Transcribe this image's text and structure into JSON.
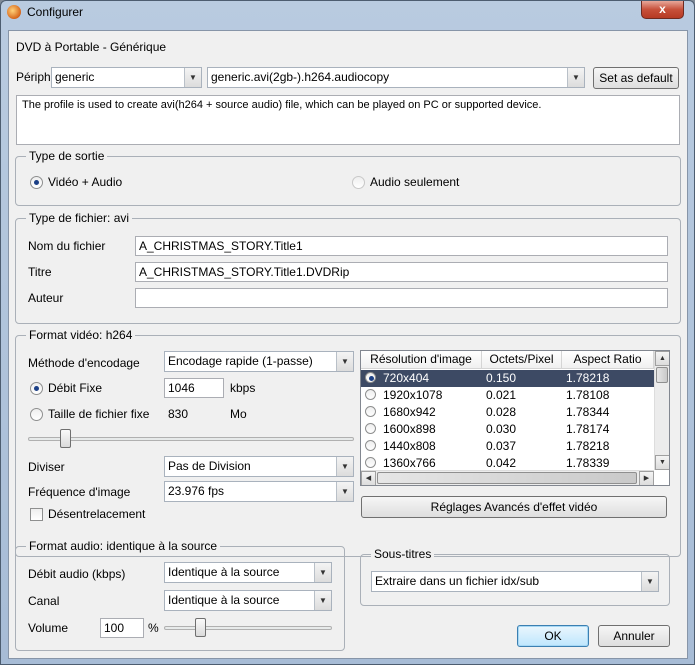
{
  "window": {
    "title": "Configurer",
    "close_glyph": "x"
  },
  "profile_name": "DVD à Portable - Générique",
  "device": {
    "label": "Périph",
    "value": "generic",
    "profile_value": "generic.avi(2gb-).h264.audiocopy",
    "set_default_label": "Set as default"
  },
  "description": "The profile is used to create avi(h264 + source audio) file, which can be played on PC or supported device.",
  "output_type": {
    "title": "Type de sortie",
    "video_audio": "Vidéo + Audio",
    "audio_only": "Audio seulement",
    "selected": "video_audio"
  },
  "file_type": {
    "title": "Type de fichier: avi",
    "filename_label": "Nom du fichier",
    "filename_value": "A_CHRISTMAS_STORY.Title1",
    "title_label": "Titre",
    "title_value": "A_CHRISTMAS_STORY.Title1.DVDRip",
    "author_label": "Auteur",
    "author_value": ""
  },
  "video": {
    "title": "Format vidéo: h264",
    "encoding_label": "Méthode d'encodage",
    "encoding_value": "Encodage rapide (1-passe)",
    "fixed_bitrate_label": "Débit Fixe",
    "fixed_bitrate_value": "1046",
    "bitrate_unit": "kbps",
    "fixed_size_label": "Taille de fichier fixe",
    "fixed_size_value": "830",
    "size_unit": "Mo",
    "split_label": "Diviser",
    "split_value": "Pas de Division",
    "framerate_label": "Fréquence d'image",
    "framerate_value": "23.976 fps",
    "deinterlace_label": "Désentrelacement",
    "advanced_label": "Réglages Avancés d'effet vidéo",
    "slider_fraction": 0.1
  },
  "resolution_table": {
    "columns": [
      "Résolution d'image",
      "Octets/Pixel",
      "Aspect Ratio"
    ],
    "rows": [
      {
        "res": "720x404",
        "bpp": "0.150",
        "ratio": "1.78218",
        "selected": true
      },
      {
        "res": "1920x1078",
        "bpp": "0.021",
        "ratio": "1.78108",
        "selected": false
      },
      {
        "res": "1680x942",
        "bpp": "0.028",
        "ratio": "1.78344",
        "selected": false
      },
      {
        "res": "1600x898",
        "bpp": "0.030",
        "ratio": "1.78174",
        "selected": false
      },
      {
        "res": "1440x808",
        "bpp": "0.037",
        "ratio": "1.78218",
        "selected": false
      },
      {
        "res": "1360x766",
        "bpp": "0.042",
        "ratio": "1.78339",
        "selected": false
      }
    ]
  },
  "audio": {
    "title": "Format audio: identique à la source",
    "bitrate_label": "Débit audio (kbps)",
    "bitrate_value": "Identique à la source",
    "channel_label": "Canal",
    "channel_value": "Identique à la source",
    "volume_label": "Volume",
    "volume_value": "100",
    "volume_unit": "%",
    "volume_fraction": 0.2
  },
  "subtitles": {
    "title": "Sous-titres",
    "value": "Extraire dans un fichier idx/sub"
  },
  "buttons": {
    "ok": "OK",
    "cancel": "Annuler"
  }
}
